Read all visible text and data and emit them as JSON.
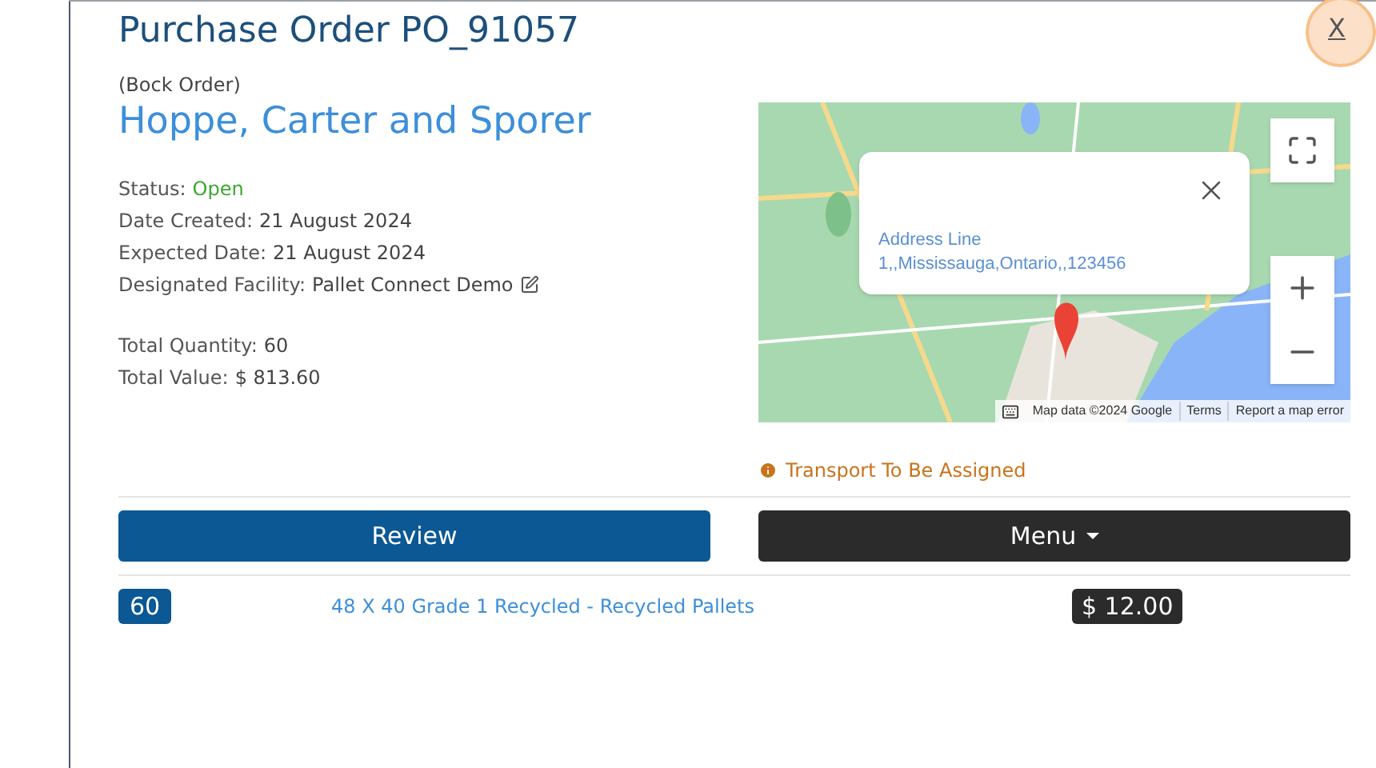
{
  "title": "Purchase Order PO_91057",
  "close_link": "X",
  "order_type": "(Bock Order)",
  "supplier": "Hoppe, Carter and Sporer",
  "details": [
    {
      "label": "Status:",
      "value": "Open",
      "kind": "status"
    },
    {
      "label": "Date Created:",
      "value": "21 August 2024",
      "kind": "text"
    },
    {
      "label": "Expected Date:",
      "value": "21 August 2024",
      "kind": "text"
    },
    {
      "label": "Designated Facility:",
      "value": "Pallet Connect Demo",
      "kind": "editable"
    }
  ],
  "totals": [
    {
      "label": "Total Quantity:",
      "value": "60"
    },
    {
      "label": "Total Value:",
      "value": "$ 813.60"
    }
  ],
  "map": {
    "popup": "Address Line 1,,Mississauga,Ontario,,123456",
    "attribution": [
      "Map data ©2024 Google",
      "Terms",
      "Report a map error"
    ]
  },
  "transport_status": "Transport To Be Assigned",
  "buttons": [
    {
      "label": "Review",
      "kind": "primary"
    },
    {
      "label": "Menu",
      "kind": "dropdown"
    }
  ],
  "line_items": [
    {
      "quantity": "60",
      "product": "48 X 40 Grade 1 Recycled - Recycled Pallets",
      "price": "$ 12.00"
    }
  ]
}
